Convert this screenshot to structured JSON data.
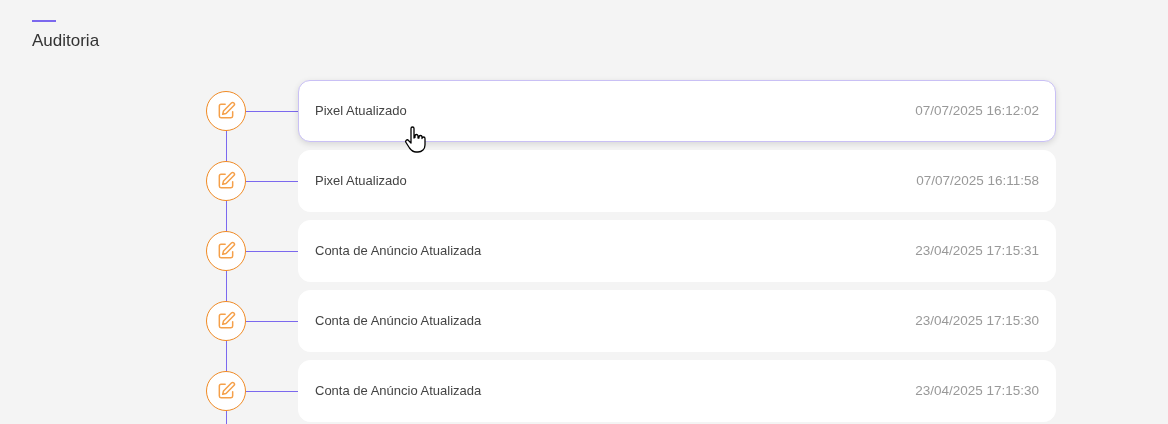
{
  "title": "Auditoria",
  "entries": [
    {
      "action": "Pixel Atualizado",
      "timestamp": "07/07/2025 16:12:02",
      "hovered": true
    },
    {
      "action": "Pixel Atualizado",
      "timestamp": "07/07/2025 16:11:58",
      "hovered": false
    },
    {
      "action": "Conta de Anúncio Atualizada",
      "timestamp": "23/04/2025 17:15:31",
      "hovered": false
    },
    {
      "action": "Conta de Anúncio Atualizada",
      "timestamp": "23/04/2025 17:15:30",
      "hovered": false
    },
    {
      "action": "Conta de Anúncio Atualizada",
      "timestamp": "23/04/2025 17:15:30",
      "hovered": false
    }
  ]
}
